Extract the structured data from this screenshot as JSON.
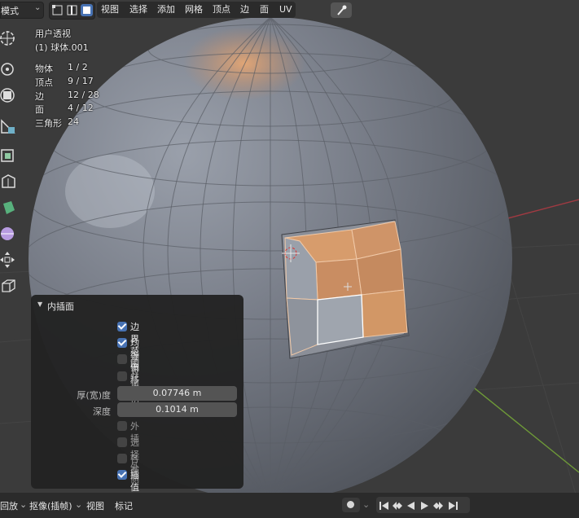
{
  "header": {
    "mode_label": "模式",
    "menus": [
      "视图",
      "选择",
      "添加",
      "网格",
      "顶点",
      "边",
      "面",
      "UV"
    ]
  },
  "overlay": {
    "view_name": "用户透视",
    "object_name": "(1) 球体.001",
    "stats": [
      {
        "label": "物体",
        "value": "1 / 2"
      },
      {
        "label": "顶点",
        "value": "9 / 17"
      },
      {
        "label": "边",
        "value": "12 / 28"
      },
      {
        "label": "面",
        "value": "4 / 12"
      },
      {
        "label": "三角形",
        "value": "24"
      }
    ]
  },
  "toolbar_icons": [
    "cursor-icon",
    "move-icon",
    "scale-icon",
    "measure-icon",
    "extrude-icon",
    "inset-icon",
    "bevel-icon",
    "loop-cut-icon",
    "transform-icon",
    "add-cube-icon"
  ],
  "panel": {
    "title": "内插面",
    "options": [
      {
        "label": "边界范围",
        "checked": true
      },
      {
        "label": "均等偏移",
        "checked": true
      },
      {
        "label": "相对偏移",
        "checked": false
      },
      {
        "label": "并排边",
        "checked": false
      }
    ],
    "thickness_label": "厚(宽)度",
    "thickness_value": "0.07746 m",
    "depth_label": "深度",
    "depth_value": "0.1014 m",
    "options2": [
      {
        "label": "外插",
        "checked": false
      },
      {
        "label": "选择外侧",
        "checked": false
      },
      {
        "label": "各面",
        "checked": false
      },
      {
        "label": "插值",
        "checked": true
      }
    ]
  },
  "footer": {
    "playback": "回放",
    "keying": "抠像(插帧)",
    "view": "视图",
    "marker": "标记"
  },
  "colors": {
    "viewport_bg": "#3b3b3b",
    "selected_face": "#d99a66",
    "active_blue": "#4772b3",
    "axis_red": "#a03a42",
    "axis_green": "#6e9a38"
  }
}
